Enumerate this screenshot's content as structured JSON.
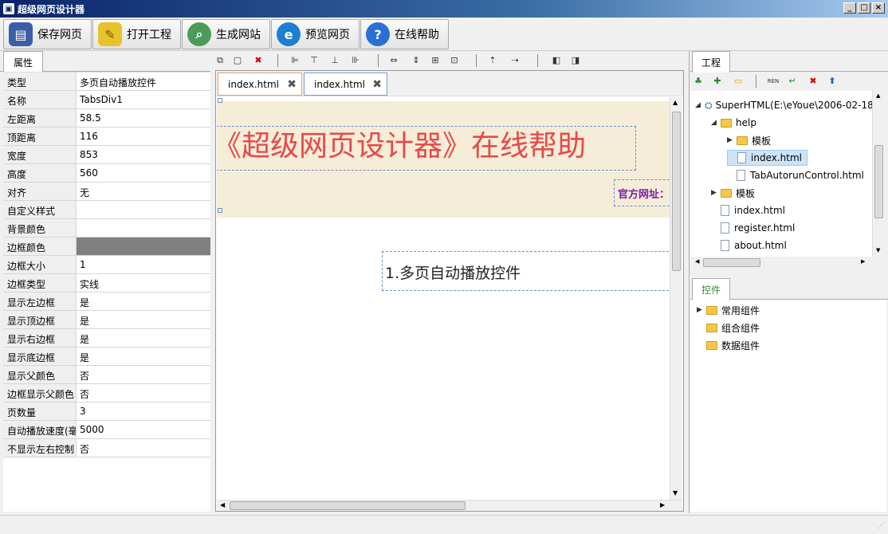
{
  "window": {
    "title": "超级网页设计器"
  },
  "toolbar": {
    "buttons": [
      {
        "label": "保存网页",
        "icon": "save-icon"
      },
      {
        "label": "打开工程",
        "icon": "open-folder-icon"
      },
      {
        "label": "生成网站",
        "icon": "generate-site-icon"
      },
      {
        "label": "预览网页",
        "icon": "ie-preview-icon"
      },
      {
        "label": "在线帮助",
        "icon": "help-icon"
      }
    ]
  },
  "properties": {
    "tab_label": "属性",
    "rows": [
      {
        "name": "类型",
        "value": "多页自动播放控件"
      },
      {
        "name": "名称",
        "value": "TabsDiv1"
      },
      {
        "name": "左距离",
        "value": "58.5"
      },
      {
        "name": "顶距离",
        "value": "116"
      },
      {
        "name": "宽度",
        "value": "853"
      },
      {
        "name": "高度",
        "value": "560"
      },
      {
        "name": "对齐",
        "value": "无"
      },
      {
        "name": "自定义样式",
        "value": ""
      },
      {
        "name": "背景颜色",
        "value": ""
      },
      {
        "name": "边框颜色",
        "value": ""
      },
      {
        "name": "边框大小",
        "value": "1"
      },
      {
        "name": "边框类型",
        "value": "实线"
      },
      {
        "name": "显示左边框",
        "value": "是"
      },
      {
        "name": "显示顶边框",
        "value": "是"
      },
      {
        "name": "显示右边框",
        "value": "是"
      },
      {
        "name": "显示底边框",
        "value": "是"
      },
      {
        "name": "显示父颜色",
        "value": "否"
      },
      {
        "name": "边框显示父颜色",
        "value": "否"
      },
      {
        "name": "页数量",
        "value": "3"
      },
      {
        "name": "自动播放速度(毫",
        "value": "5000"
      },
      {
        "name": "不显示左右控制",
        "value": "否"
      }
    ],
    "border_color": "#808080"
  },
  "editor": {
    "tabs": [
      {
        "label": "index.html"
      },
      {
        "label": "index.html"
      }
    ],
    "headline": "《超级网页设计器》在线帮助",
    "official_site": "官方网址：",
    "control_text": "1.多页自动播放控件",
    "headline_color": "#e84848",
    "band_color": "#f5edd8"
  },
  "project": {
    "tab_label": "工程",
    "tree": [
      {
        "label": "SuperHTML(E:\\eYoue\\2006-02-18",
        "type": "root"
      },
      {
        "label": "help",
        "type": "folder"
      },
      {
        "label": "模板",
        "type": "folder"
      },
      {
        "label": "index.html",
        "type": "file",
        "selected": true
      },
      {
        "label": "TabAutorunControl.html",
        "type": "file"
      },
      {
        "label": "模板",
        "type": "folder"
      },
      {
        "label": "index.html",
        "type": "file"
      },
      {
        "label": "register.html",
        "type": "file"
      },
      {
        "label": "about.html",
        "type": "file"
      }
    ]
  },
  "controls": {
    "tab_label": "控件",
    "tree": [
      {
        "label": "常用组件"
      },
      {
        "label": "组合组件"
      },
      {
        "label": "数据组件"
      }
    ]
  }
}
